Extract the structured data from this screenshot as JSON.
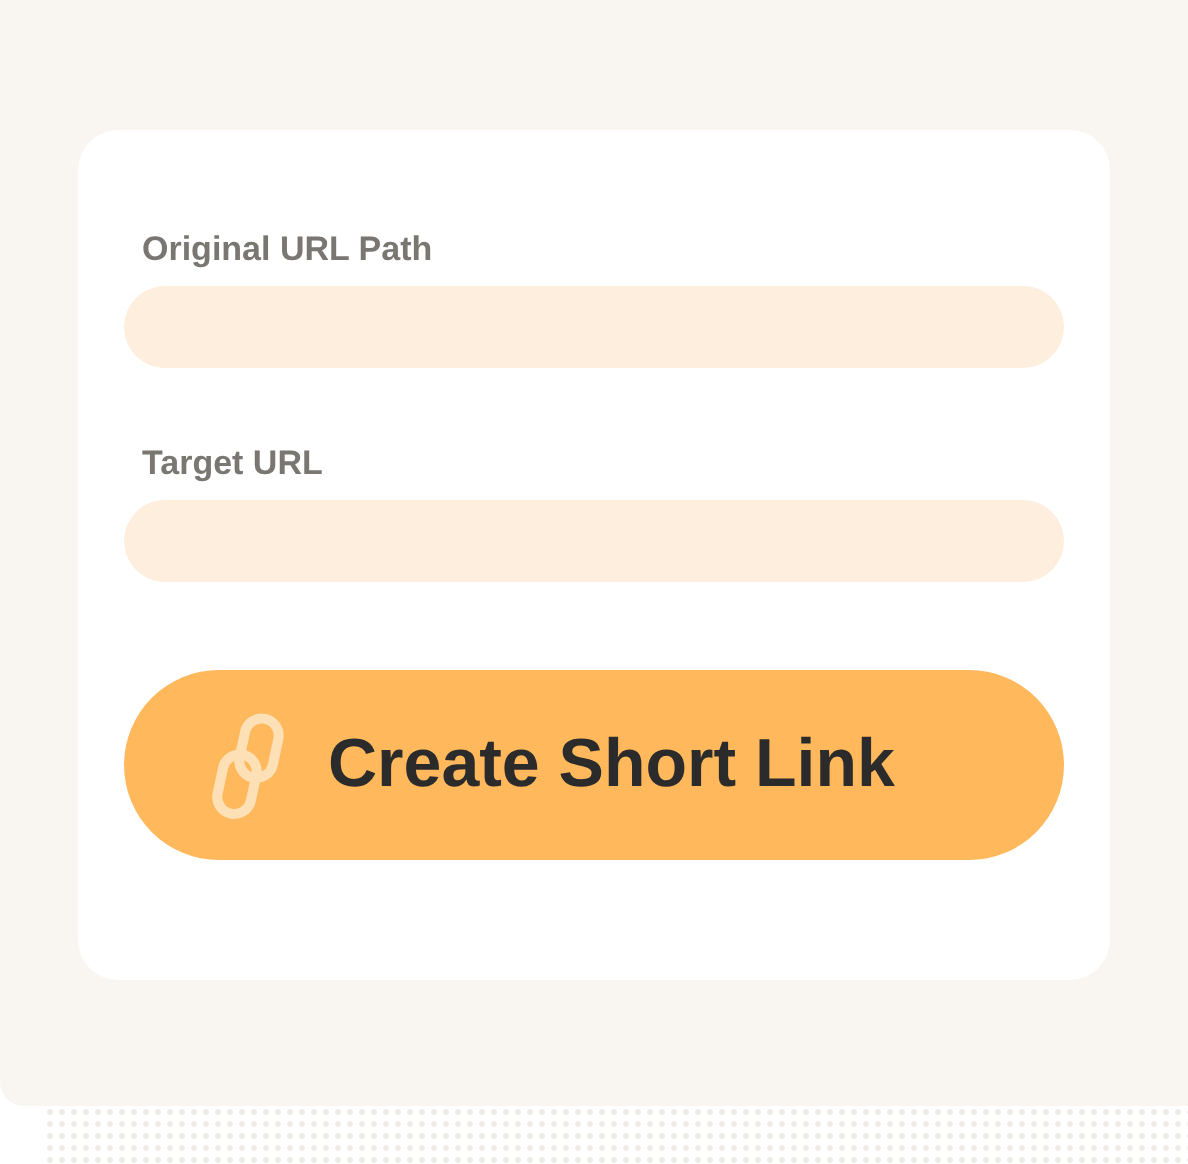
{
  "form": {
    "fields": [
      {
        "label": "Original URL Path"
      },
      {
        "label": "Target URL"
      }
    ],
    "button": {
      "label": "Create Short Link"
    }
  }
}
